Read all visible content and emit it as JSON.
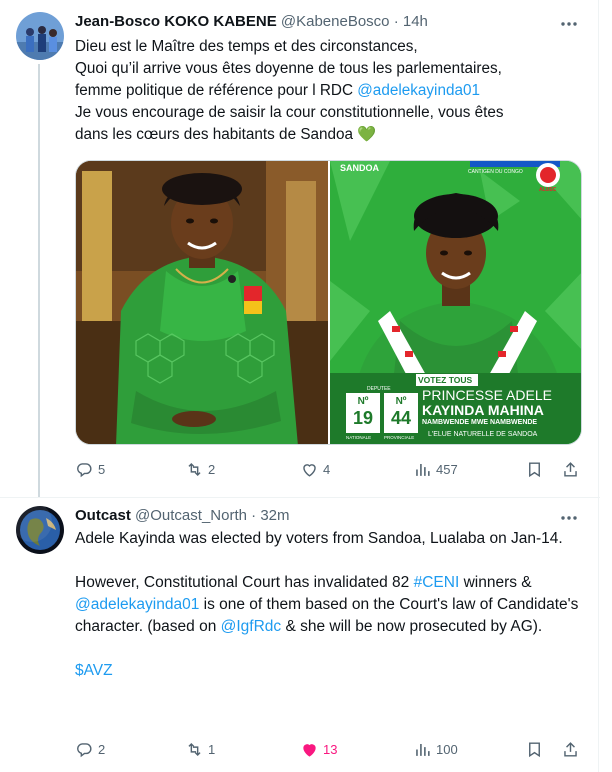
{
  "tweets": [
    {
      "author_name": "Jean-Bosco KOKO KABENE",
      "handle": "@KabeneBosco",
      "separator": "·",
      "time": "14h",
      "lines": [
        "Dieu est le Maître des temps et des circonstances,",
        "Quoi qu’il arrive vous êtes doyenne de tous les parlementaires,",
        "femme politique  de référence pour l RDC ",
        "@adelekayinda01",
        "Je vous encourage de saisir la cour constitutionnelle, vous êtes",
        "dans les cœurs des habitants de Sandoa",
        "💚"
      ],
      "poster": {
        "top_label": "SANDOA",
        "party_label": "CANTIGEN DU CONGO",
        "party_short": "ALUSC",
        "vote_label": "VOTEZ TOUS",
        "deputy_label": "DEPUTEE",
        "national_number": "19",
        "national_label": "NATIONALE",
        "provincial_number": "44",
        "provincial_label": "PROVINCIALE",
        "name_line1": "PRINCESSE ADELE",
        "name_line2": "KAYINDA MAHINA",
        "name_line3": "NAMBWENDE MWE NAMBWENDE",
        "slogan": "L'ELUE NATURELLE DE SANDOA"
      },
      "stats": {
        "replies": "5",
        "reposts": "2",
        "likes": "4",
        "views": "457"
      }
    },
    {
      "author_name": "Outcast",
      "handle": "@Outcast_North",
      "separator": "·",
      "time": "32m",
      "p1": "Adele Kayinda was elected by voters from Sandoa, Lualaba on Jan-14.",
      "p2_a": "However, Constitutional Court has invalidated 82 ",
      "p2_hashtag": "#CENI",
      "p2_b": " winners & ",
      "p2_mention": "@adelekayinda01",
      "p2_c": " is one of them based on the Court's law of Candidate's character. (based on ",
      "p2_mention2": "@IgfRdc",
      "p2_d": " & she will be now prosecuted by AG).",
      "cashtag": "$AVZ",
      "stats": {
        "replies": "2",
        "reposts": "1",
        "likes": "13",
        "views": "100"
      }
    }
  ],
  "colors": {
    "link": "#1d9bf0",
    "muted": "#536471",
    "like_active": "#f91880",
    "poster_green": "#2fae3c"
  },
  "icons": [
    "more-icon",
    "reply-icon",
    "repost-icon",
    "like-icon",
    "views-icon",
    "bookmark-icon",
    "share-icon",
    "green-heart-emoji"
  ]
}
